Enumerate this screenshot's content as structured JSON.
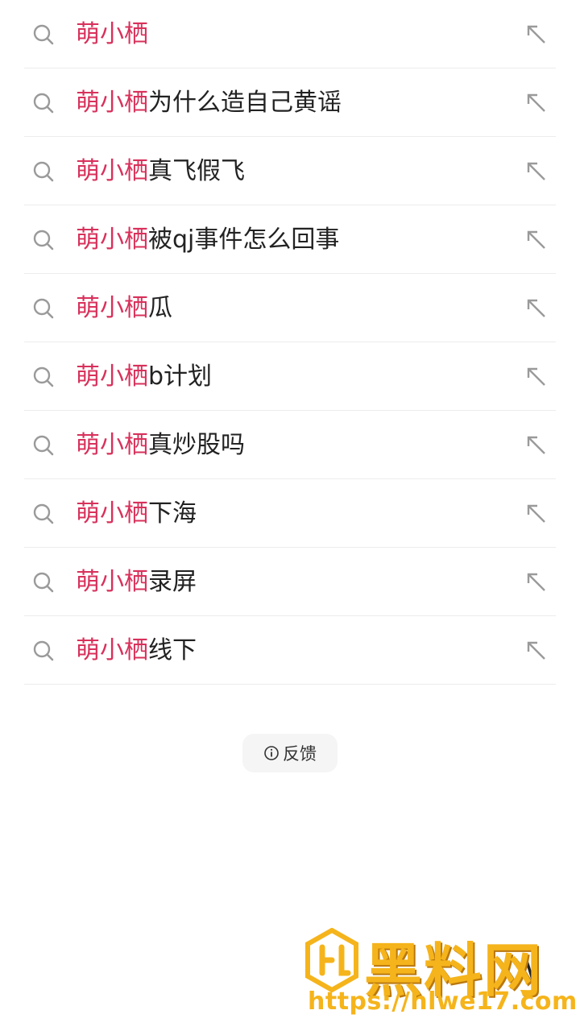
{
  "suggestions": [
    {
      "highlight": "萌小栖",
      "rest": ""
    },
    {
      "highlight": "萌小栖",
      "rest": "为什么造自己黄谣"
    },
    {
      "highlight": "萌小栖",
      "rest": "真飞假飞"
    },
    {
      "highlight": "萌小栖",
      "rest": "被qj事件怎么回事"
    },
    {
      "highlight": "萌小栖",
      "rest": "瓜"
    },
    {
      "highlight": "萌小栖",
      "rest": "b计划"
    },
    {
      "highlight": "萌小栖",
      "rest": "真炒股吗"
    },
    {
      "highlight": "萌小栖",
      "rest": "下海"
    },
    {
      "highlight": "萌小栖",
      "rest": "录屏"
    },
    {
      "highlight": "萌小栖",
      "rest": "线下"
    }
  ],
  "feedback": {
    "label": "反馈",
    "icon": "info-icon"
  },
  "watermark": {
    "brand": "黑料网",
    "url": "https://hlwe17.com"
  },
  "corner_glyph": "/\\",
  "colors": {
    "highlight": "#d8315b",
    "text": "#222222",
    "watermark": "#f5b41b"
  }
}
